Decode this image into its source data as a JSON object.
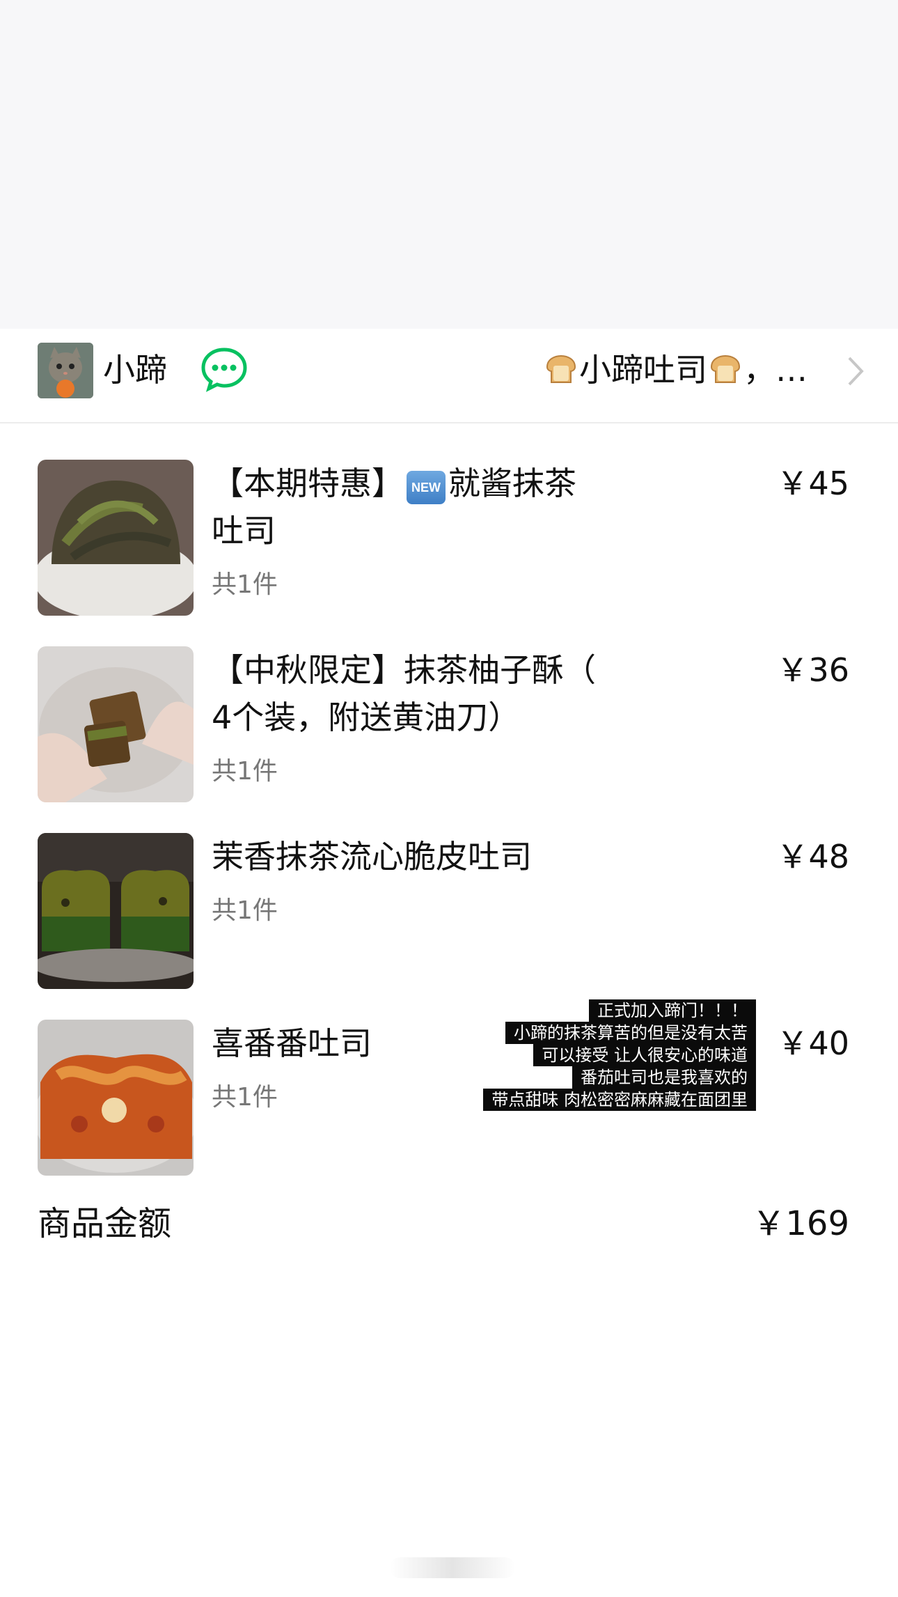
{
  "shop": {
    "name": "小蹄",
    "store_title": "小蹄吐司",
    "store_title_suffix": "，…"
  },
  "items": [
    {
      "title_prefix": "【本期特惠】",
      "badge": "NEW",
      "title_main": "就酱抹茶",
      "title_line2": "吐司",
      "qty": "共1件",
      "price": "￥45"
    },
    {
      "title_line1": "【中秋限定】抹茶柚子酥（",
      "title_line2": "4个装，附送黄油刀）",
      "qty": "共1件",
      "price": "￥36"
    },
    {
      "title_line1": "茉香抹茶流心脆皮吐司",
      "qty": "共1件",
      "price": "￥48"
    },
    {
      "title_line1": "喜番番吐司",
      "qty": "共1件",
      "price": "￥40"
    }
  ],
  "note": [
    "正式加入蹄门！！！",
    "小蹄的抹茶算苦的但是没有太苦",
    "可以接受 让人很安心的味道",
    "番茄吐司也是我喜欢的",
    "带点甜味 肉松密密麻麻藏在面团里"
  ],
  "summary": {
    "label": "商品金额",
    "value": "￥169"
  },
  "colors": {
    "chat_green": "#07c160",
    "background_top": "#f7f7f9"
  }
}
